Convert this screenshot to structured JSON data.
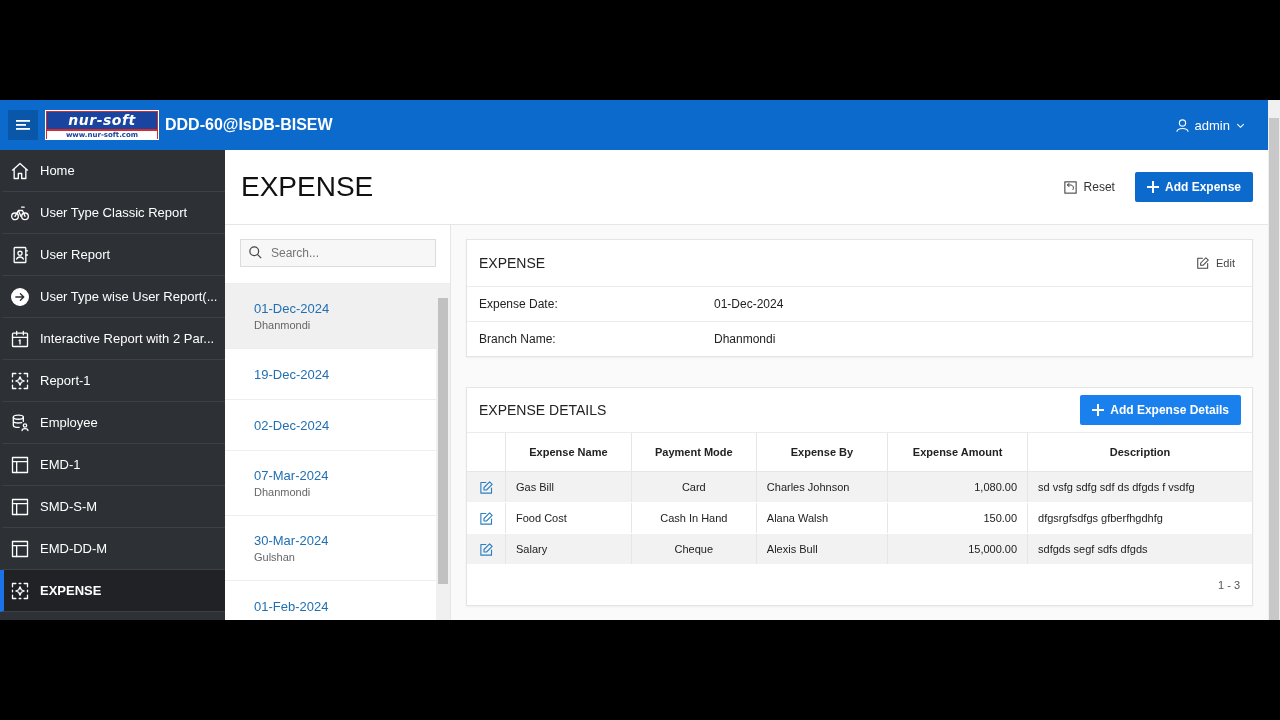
{
  "header": {
    "logo": {
      "name": "nur-soft",
      "url": "www.nur-soft.com"
    },
    "app_title": "DDD-60@IsDB-BISEW",
    "user": "admin"
  },
  "sidebar": {
    "items": [
      {
        "label": "Home",
        "selected": false
      },
      {
        "label": "User Type Classic Report",
        "selected": false
      },
      {
        "label": "User Report",
        "selected": false
      },
      {
        "label": "User Type wise User Report(...",
        "selected": false
      },
      {
        "label": "Interactive Report with 2 Par...",
        "selected": false
      },
      {
        "label": "Report-1",
        "selected": false
      },
      {
        "label": "Employee",
        "selected": false
      },
      {
        "label": "EMD-1",
        "selected": false
      },
      {
        "label": "SMD-S-M",
        "selected": false
      },
      {
        "label": "EMD-DD-M",
        "selected": false
      },
      {
        "label": "EXPENSE",
        "selected": true
      }
    ]
  },
  "page": {
    "title": "EXPENSE",
    "reset_button": "Reset",
    "add_button": "Add Expense"
  },
  "master_list": {
    "search": {
      "placeholder": "Search..."
    },
    "items": [
      {
        "date": "01-Dec-2024",
        "branch": "Dhanmondi",
        "selected": true
      },
      {
        "date": "19-Dec-2024",
        "selected": false
      },
      {
        "date": "02-Dec-2024",
        "selected": false
      },
      {
        "date": "07-Mar-2024",
        "branch": "Dhanmondi",
        "selected": false
      },
      {
        "date": "30-Mar-2024",
        "branch": "Gulshan",
        "selected": false
      },
      {
        "date": "01-Feb-2024",
        "selected": false
      }
    ]
  },
  "expense_card": {
    "title": "EXPENSE",
    "edit_button": "Edit",
    "fields": [
      {
        "label": "Expense Date:",
        "value": "01-Dec-2024"
      },
      {
        "label": "Branch Name:",
        "value": "Dhanmondi"
      }
    ]
  },
  "details_card": {
    "title": "EXPENSE DETAILS",
    "add_button": "Add Expense Details",
    "table": {
      "columns": [
        "Expense Name",
        "Payment Mode",
        "Expense By",
        "Expense Amount",
        "Description"
      ],
      "rows": [
        [
          "Gas Bill",
          "Card",
          "Charles Johnson",
          "1,080.00",
          "sd vsfg sdfg sdf ds dfgds f vsdfg"
        ],
        [
          "Food Cost",
          "Cash In Hand",
          "Alana Walsh",
          "150.00",
          "dfgsrgfsdfgs gfberfhgdhfg"
        ],
        [
          "Salary",
          "Cheque",
          "Alexis Bull",
          "15,000.00",
          "sdfgds segf sdfs dfgds"
        ]
      ]
    },
    "pagination": "1 - 3"
  }
}
